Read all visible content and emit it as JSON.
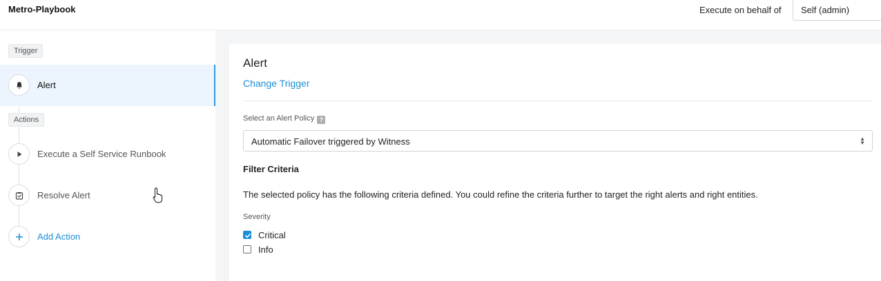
{
  "header": {
    "app_title": "Metro-Playbook",
    "behalf_label": "Execute on behalf of",
    "behalf_value": "Self (admin)"
  },
  "sidebar": {
    "trigger_tag": "Trigger",
    "trigger_step": {
      "label": "Alert",
      "icon": "bell-icon"
    },
    "actions_tag": "Actions",
    "action_steps": [
      {
        "label": "Execute a Self Service Runbook",
        "icon": "play-icon"
      },
      {
        "label": "Resolve Alert",
        "icon": "clipboard-check-icon"
      }
    ],
    "add_action": {
      "label": "Add Action",
      "icon": "plus-icon"
    }
  },
  "panel": {
    "title": "Alert",
    "change_trigger": "Change Trigger",
    "policy_label": "Select an Alert Policy",
    "help_glyph": "?",
    "policy_value": "Automatic Failover triggered by Witness",
    "filter_heading": "Filter Criteria",
    "criteria_text": "The selected policy has the following criteria defined. You could refine the criteria further to target the right alerts and right entities.",
    "severity_label": "Severity",
    "severities": [
      {
        "label": "Critical",
        "checked": true
      },
      {
        "label": "Info",
        "checked": false
      }
    ]
  },
  "colors": {
    "accent": "#1b8fd8",
    "active_bg": "#ecf5fd",
    "content_bg": "#f4f5f6"
  }
}
